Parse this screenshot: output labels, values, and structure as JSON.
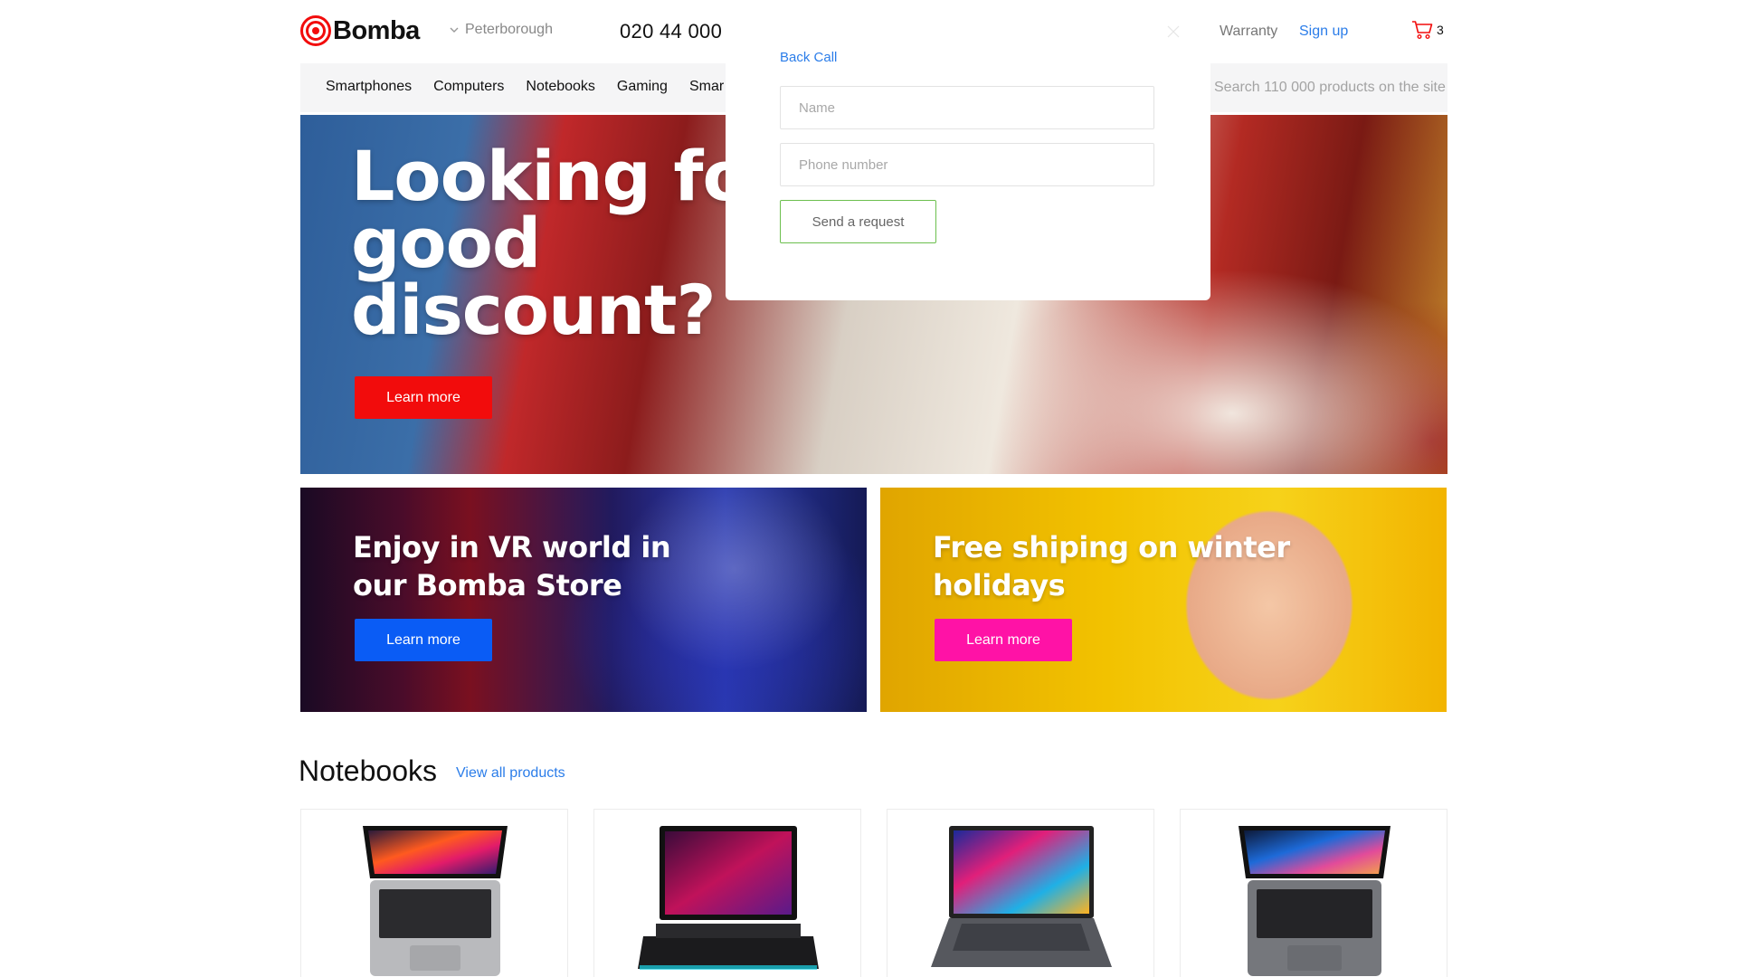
{
  "header": {
    "brand": "Bomba",
    "city": "Peterborough",
    "phone": "020 44 000",
    "warranty": "Warranty",
    "signup": "Sign up",
    "cart_count": "3"
  },
  "nav": {
    "items": [
      "Smartphones",
      "Computers",
      "Notebooks",
      "Gaming",
      "Smar"
    ],
    "search_hint": "Search 110 000 products on the site"
  },
  "hero": {
    "title": "Looking for good discount?",
    "button": "Learn more"
  },
  "promos": [
    {
      "title": "Enjoy in VR world in our Bomba Store",
      "button": "Learn more",
      "button_color": "#0a5cf5"
    },
    {
      "title": "Free shiping on winter holidays",
      "button": "Learn more",
      "button_color": "#ff12a6"
    }
  ],
  "section": {
    "title": "Notebooks",
    "view_all": "View all products"
  },
  "back_call": {
    "title": "Back Call",
    "name_placeholder": "Name",
    "phone_placeholder": "Phone number",
    "submit": "Send a request"
  },
  "colors": {
    "brand_red": "#f20c0c",
    "link_blue": "#2b7de9",
    "submit_border": "#6cbf4e"
  },
  "icons": [
    "logo-target-icon",
    "chevron-down-icon",
    "close-icon",
    "cart-icon"
  ]
}
